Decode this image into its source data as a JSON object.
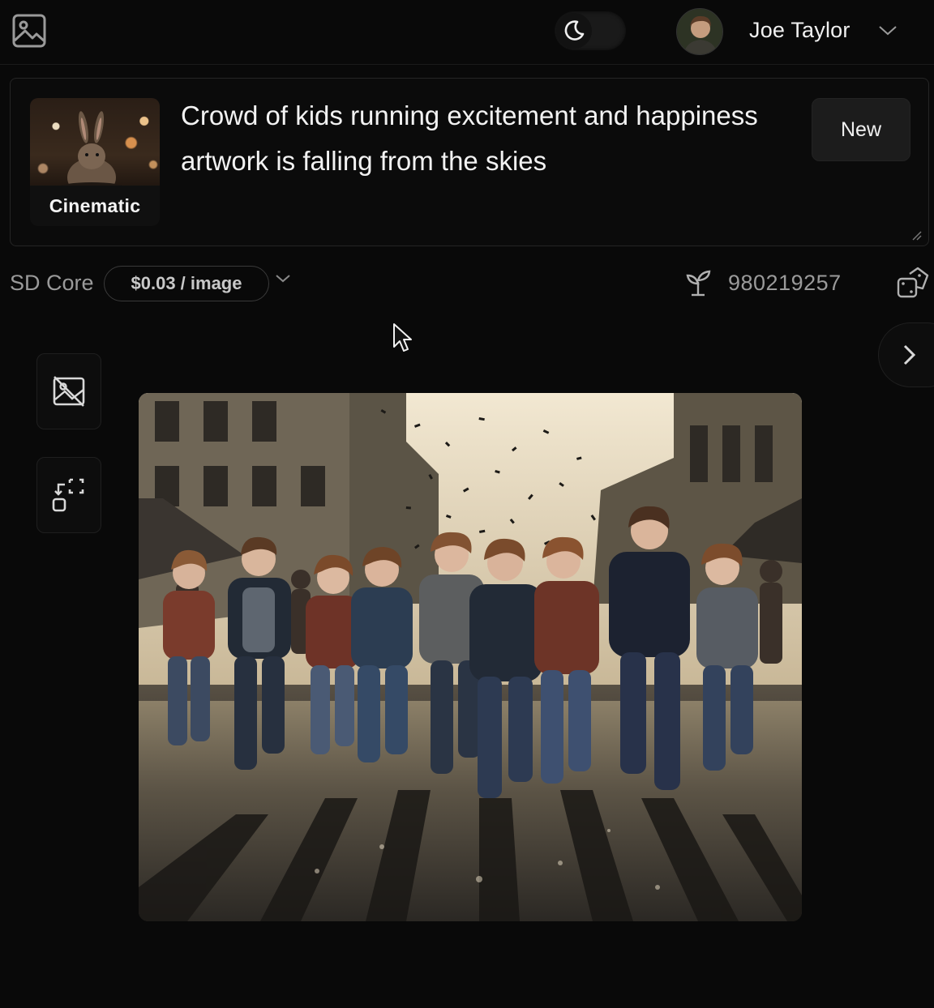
{
  "header": {
    "user_name": "Joe Taylor"
  },
  "prompt": {
    "style_label": "Cinematic",
    "text": "Crowd of kids running excitement and happiness artwork is falling from the skies",
    "new_button_label": "New"
  },
  "options": {
    "model_name": "SD Core",
    "price_label": "$0.03 / image",
    "seed": "980219257"
  },
  "icons": {
    "logo": "image-icon",
    "theme": "moon-icon",
    "user_menu": "chevron-down-icon",
    "model_menu": "chevron-down-icon",
    "seed": "seedling-icon",
    "randomize": "dice-icon",
    "remove_background": "image-off-icon",
    "upscale": "expand-icon",
    "next": "chevron-right-icon"
  },
  "colors": {
    "background": "#090909",
    "text": "#f2f2f2",
    "muted": "#9a9a9a"
  }
}
